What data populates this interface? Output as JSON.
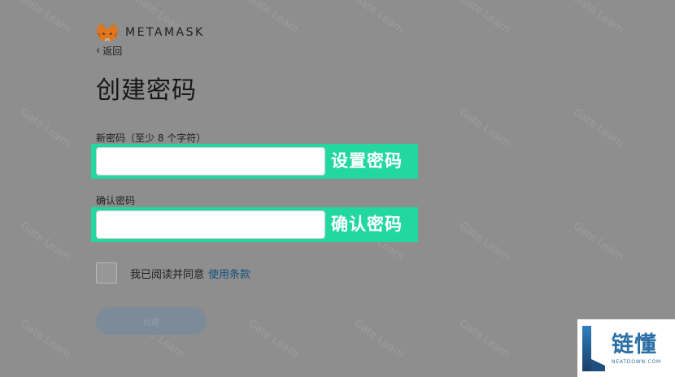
{
  "header": {
    "brand": "METAMASK"
  },
  "nav": {
    "back_label": "返回"
  },
  "page": {
    "title": "创建密码"
  },
  "form": {
    "new_password": {
      "label": "新密码（至少 8 个字符）",
      "value": "",
      "callout": "设置密码"
    },
    "confirm_password": {
      "label": "确认密码",
      "value": "",
      "callout": "确认密码"
    },
    "terms": {
      "text": "我已阅读并同意",
      "link": "使用条款",
      "checked": false
    },
    "submit_label": "创建"
  },
  "watermark": {
    "text": "Gate Learn"
  },
  "logo": {
    "cn": "链懂",
    "en": "NEATDOWN.COM"
  },
  "colors": {
    "highlight": "#22d7a0",
    "link": "#14507f",
    "overlay": "#8e8e8e",
    "button_disabled": "#7d8a98"
  }
}
